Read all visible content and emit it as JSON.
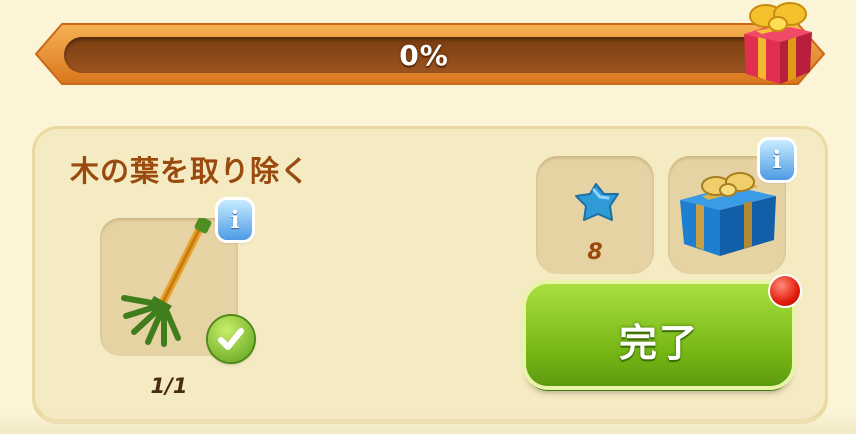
{
  "progress": {
    "label": "0%",
    "value": 0,
    "reward_icon": "gift-box-icon"
  },
  "task": {
    "title": "木の葉を取り除く",
    "required_item": {
      "icon": "rake-icon",
      "count": "1/1",
      "completed": true
    },
    "rewards": [
      {
        "icon": "blue-star-gem-icon",
        "amount": "8"
      },
      {
        "icon": "blue-gift-box-icon"
      }
    ],
    "complete_button_label": "完了"
  },
  "colors": {
    "title": "#9a4a0e",
    "button_green": "#74b514",
    "progress_track": "#7a3d10",
    "panel": "#f5ebc2",
    "notification_red": "#e21c0c"
  }
}
